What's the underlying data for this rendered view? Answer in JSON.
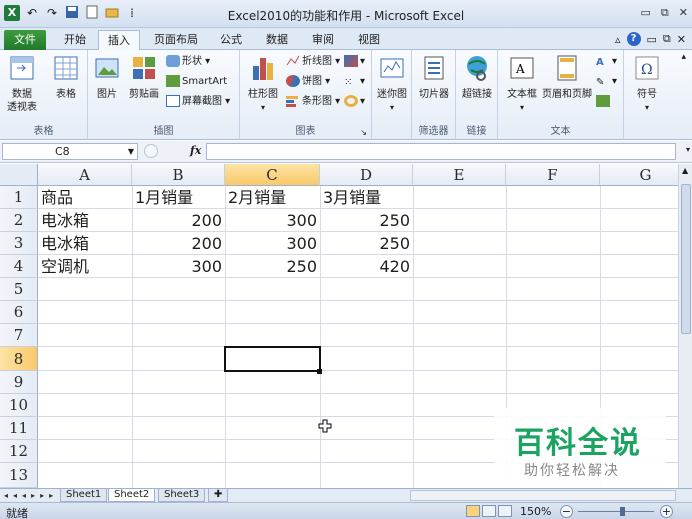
{
  "window": {
    "title": "Excel2010的功能和作用 - Microsoft Excel"
  },
  "qat": {
    "undo": "↶",
    "redo": "↷"
  },
  "tabs": [
    {
      "label": "文件"
    },
    {
      "label": "开始"
    },
    {
      "label": "插入"
    },
    {
      "label": "页面布局"
    },
    {
      "label": "公式"
    },
    {
      "label": "数据"
    },
    {
      "label": "审阅"
    },
    {
      "label": "视图"
    }
  ],
  "ribbon": {
    "groups": {
      "tables": {
        "name": "表格",
        "pivot": "数据\n透视表",
        "table": "表格"
      },
      "illustrations": {
        "name": "插图",
        "picture": "图片",
        "clipart": "剪贴画",
        "shapes": "形状",
        "smartart": "SmartArt",
        "screenshot": "屏幕截图"
      },
      "charts": {
        "name": "图表",
        "column": "柱形图",
        "line": "折线图",
        "pie": "饼图",
        "bar": "条形图"
      },
      "sparklines": {
        "name": "",
        "label": "迷你图"
      },
      "filter": {
        "name": "筛选器",
        "slicer": "切片器"
      },
      "links": {
        "name": "链接",
        "hyperlink": "超链接"
      },
      "text": {
        "name": "文本",
        "textbox": "文本框",
        "header": "页眉和页脚"
      },
      "symbols": {
        "name": "",
        "symbol": "符号"
      }
    }
  },
  "formula_bar": {
    "name_box": "C8",
    "fx": "fx",
    "value": ""
  },
  "sheet": {
    "columns": [
      "A",
      "B",
      "C",
      "D",
      "E",
      "F",
      "G"
    ],
    "rows": [
      "1",
      "2",
      "3",
      "4",
      "5",
      "6",
      "7",
      "8",
      "9",
      "10",
      "11",
      "12",
      "13"
    ],
    "cells": {
      "A1": "商品",
      "B1": "1月销量",
      "C1": "2月销量",
      "D1": "3月销量",
      "A2": "电冰箱",
      "B2": "200",
      "C2": "300",
      "D2": "250",
      "A3": "电冰箱",
      "B3": "200",
      "C3": "300",
      "D3": "250",
      "A4": "空调机",
      "B4": "300",
      "C4": "250",
      "D4": "420"
    },
    "active_cell": "C8"
  },
  "sheet_tabs": [
    "Sheet1",
    "Sheet2",
    "Sheet3"
  ],
  "status": {
    "ready": "就绪",
    "zoom": "150%"
  },
  "watermark": {
    "main": "百科全说",
    "sub": "助你轻松解决"
  }
}
